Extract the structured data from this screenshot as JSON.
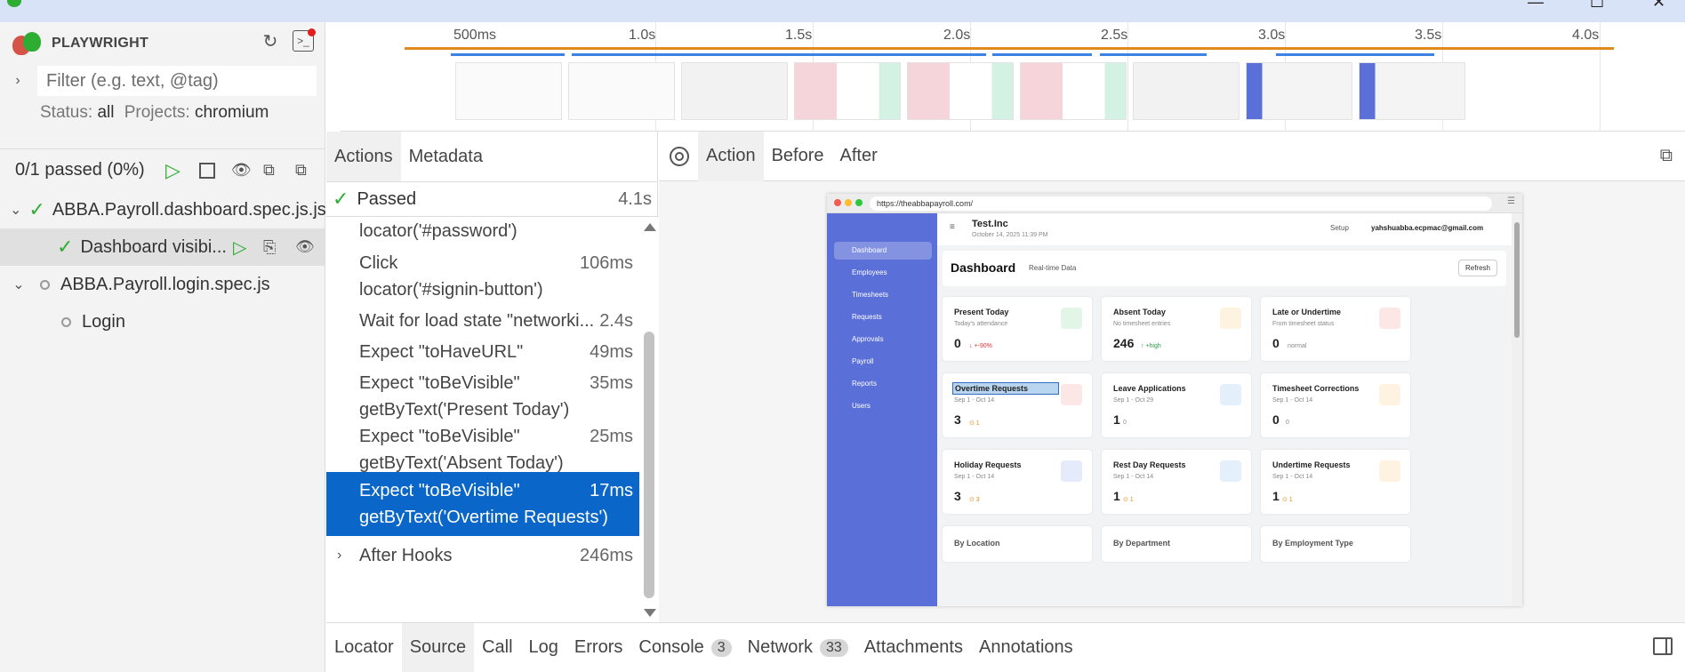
{
  "sidebar": {
    "brand": "PLAYWRIGHT",
    "filter_placeholder": "Filter (e.g. text, @tag)",
    "status_label": "Status:",
    "status_value": "all",
    "projects_label": "Projects:",
    "projects_value": "chromium",
    "passed_summary": "0/1 passed (0%)",
    "tree": [
      {
        "label": "ABBA.Payroll.dashboard.spec.js.js",
        "state": "passed"
      },
      {
        "label": "Dashboard visibi...",
        "state": "passed"
      },
      {
        "label": "ABBA.Payroll.login.spec.js",
        "state": "pending"
      },
      {
        "label": "Login",
        "state": "pending"
      }
    ]
  },
  "timeline": {
    "ticks": [
      "500ms",
      "1.0s",
      "1.5s",
      "2.0s",
      "2.5s",
      "3.0s",
      "3.5s",
      "4.0s"
    ]
  },
  "actions_panel": {
    "tabs": [
      "Actions",
      "Metadata"
    ],
    "status": "Passed",
    "status_duration": "4.1s",
    "items": [
      {
        "line1": "locator('#password')",
        "line2": "",
        "duration": ""
      },
      {
        "line1": "Click",
        "line2": "locator('#signin-button')",
        "duration": "106ms"
      },
      {
        "line1": "Wait for load state \"networki...",
        "line2": "",
        "duration": "2.4s"
      },
      {
        "line1": "Expect \"toHaveURL\"",
        "line2": "",
        "duration": "49ms"
      },
      {
        "line1": "Expect \"toBeVisible\"",
        "line2": "getByText('Present Today')",
        "duration": "35ms"
      },
      {
        "line1": "Expect \"toBeVisible\"",
        "line2": "getByText('Absent Today')",
        "duration": "25ms"
      },
      {
        "line1": "Expect \"toBeVisible\"",
        "line2": "getByText('Overtime Requests')",
        "duration": "17ms"
      },
      {
        "line1": "After Hooks",
        "line2": "",
        "duration": "246ms"
      }
    ]
  },
  "preview": {
    "tabs": [
      "Action",
      "Before",
      "After"
    ],
    "url": "https://theabbapayroll.com/",
    "company": "Test.Inc",
    "datetime": "October 14, 2025 11:39 PM",
    "setup": "Setup",
    "user": "yahshuabba.ecpmac@gmail.com",
    "nav": [
      "Dashboard",
      "Employees",
      "Timesheets",
      "Requests",
      "Approvals",
      "Payroll",
      "Reports",
      "Users"
    ],
    "dash_title": "Dashboard",
    "dash_sub": "Real-time Data",
    "refresh": "Refresh",
    "cards": [
      {
        "title": "Present Today",
        "sub": "Today's attendance",
        "value": "0",
        "extra": "↓ +-90%",
        "color": "#e2f5e7"
      },
      {
        "title": "Absent Today",
        "sub": "No timesheet entries",
        "value": "246",
        "extra": "↑ +high",
        "color": "#fdf3e0"
      },
      {
        "title": "Late or Undertime",
        "sub": "From timesheet status",
        "value": "0",
        "extra": "normal",
        "color": "#fde6e6"
      },
      {
        "title": "Overtime Requests",
        "sub": "Sep 1 - Oct 14",
        "value": "3",
        "extra": "⊙ 1",
        "color": "#fde6e6"
      },
      {
        "title": "Leave Applications",
        "sub": "Sep 1 - Oct 29",
        "value": "1",
        "extra": "0",
        "color": "#e3f0fb"
      },
      {
        "title": "Timesheet Corrections",
        "sub": "Sep 1 - Oct 14",
        "value": "0",
        "extra": "0",
        "color": "#fdf3e0"
      },
      {
        "title": "Holiday Requests",
        "sub": "Sep 1 - Oct 14",
        "value": "3",
        "extra": "⊙ 3",
        "color": "#e6ebfb"
      },
      {
        "title": "Rest Day Requests",
        "sub": "Sep 1 - Oct 14",
        "value": "1",
        "extra": "⊙ 1",
        "color": "#e3f0fb"
      },
      {
        "title": "Undertime Requests",
        "sub": "Sep 1 - Oct 14",
        "value": "1",
        "extra": "⊙ 1",
        "color": "#fdf3e0"
      }
    ],
    "bottom_labels": [
      "By Location",
      "By Department",
      "By Employment Type"
    ]
  },
  "bottom_tabs": [
    {
      "label": "Locator",
      "badge": ""
    },
    {
      "label": "Source",
      "badge": ""
    },
    {
      "label": "Call",
      "badge": ""
    },
    {
      "label": "Log",
      "badge": ""
    },
    {
      "label": "Errors",
      "badge": ""
    },
    {
      "label": "Console",
      "badge": "3"
    },
    {
      "label": "Network",
      "badge": "33"
    },
    {
      "label": "Attachments",
      "badge": ""
    },
    {
      "label": "Annotations",
      "badge": ""
    }
  ]
}
